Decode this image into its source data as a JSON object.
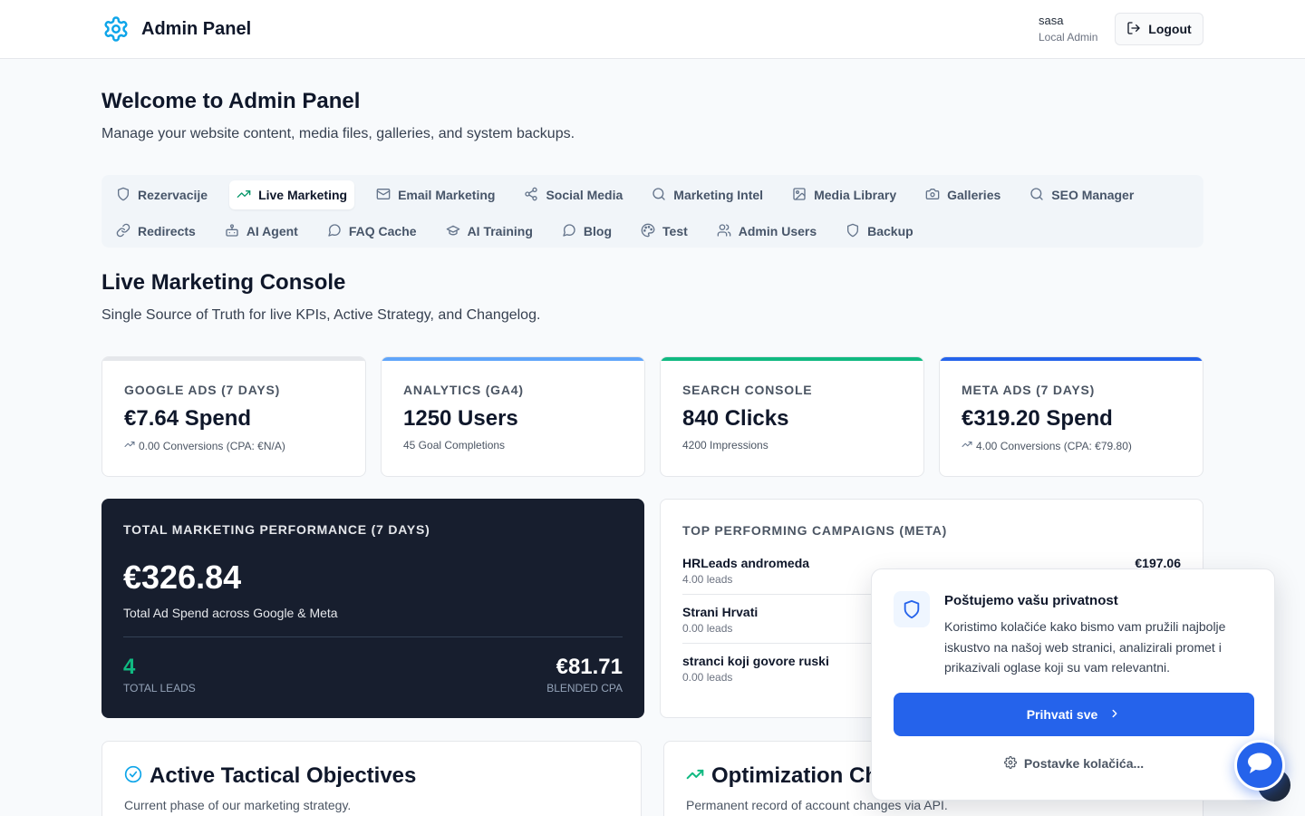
{
  "header": {
    "brand_title": "Admin Panel",
    "brand_icon": "gear-icon",
    "user_name": "sasa",
    "user_role": "Local Admin",
    "logout_label": "Logout"
  },
  "welcome": {
    "title": "Welcome to Admin Panel",
    "subtitle": "Manage your website content, media files, galleries, and system backups."
  },
  "tabs": [
    {
      "label": "Rezervacije",
      "icon": "shield-icon"
    },
    {
      "label": "Live Marketing",
      "icon": "trending-up-icon",
      "active": true
    },
    {
      "label": "Email Marketing",
      "icon": "mail-icon"
    },
    {
      "label": "Social Media",
      "icon": "share-icon"
    },
    {
      "label": "Marketing Intel",
      "icon": "search-icon"
    },
    {
      "label": "Media Library",
      "icon": "image-icon"
    },
    {
      "label": "Galleries",
      "icon": "camera-icon"
    },
    {
      "label": "SEO Manager",
      "icon": "search-icon"
    },
    {
      "label": "Redirects",
      "icon": "link-icon"
    },
    {
      "label": "AI Agent",
      "icon": "bot-icon"
    },
    {
      "label": "FAQ Cache",
      "icon": "message-circle-icon"
    },
    {
      "label": "AI Training",
      "icon": "graduation-cap-icon"
    },
    {
      "label": "Blog",
      "icon": "message-square-icon"
    },
    {
      "label": "Test",
      "icon": "palette-icon"
    },
    {
      "label": "Admin Users",
      "icon": "users-icon"
    },
    {
      "label": "Backup",
      "icon": "shield-icon"
    }
  ],
  "console": {
    "title": "Live Marketing Console",
    "subtitle": "Single Source of Truth for live KPIs, Active Strategy, and Changelog."
  },
  "kpis": [
    {
      "label": "GOOGLE ADS (7 DAYS)",
      "value": "€7.64 Spend",
      "detail": "0.00 Conversions (CPA: €N/A)",
      "accent": "#e5e7eb",
      "trend_icon": true
    },
    {
      "label": "ANALYTICS (GA4)",
      "value": "1250 Users",
      "detail": "45 Goal Completions",
      "accent": "#60a5fa",
      "trend_icon": false
    },
    {
      "label": "SEARCH CONSOLE",
      "value": "840 Clicks",
      "detail": "4200 Impressions",
      "accent": "#10b981",
      "trend_icon": false
    },
    {
      "label": "META ADS (7 DAYS)",
      "value": "€319.20 Spend",
      "detail": "4.00 Conversions (CPA: €79.80)",
      "accent": "#2563eb",
      "trend_icon": true
    }
  ],
  "performance": {
    "label": "TOTAL MARKETING PERFORMANCE (7 DAYS)",
    "total": "€326.84",
    "description": "Total Ad Spend across Google & Meta",
    "leads_value": "4",
    "leads_label": "TOTAL LEADS",
    "cpa_value": "€81.71",
    "cpa_label": "BLENDED CPA"
  },
  "campaigns": {
    "title": "TOP PERFORMING CAMPAIGNS (META)",
    "items": [
      {
        "name": "HRLeads andromeda",
        "leads": "4.00 leads",
        "spend": "€197.06"
      },
      {
        "name": "Strani Hrvati",
        "leads": "0.00 leads",
        "spend": ""
      },
      {
        "name": "stranci koji govore ruski",
        "leads": "0.00 leads",
        "spend": ""
      }
    ]
  },
  "objectives": {
    "title": "Active Tactical Objectives",
    "subtitle": "Current phase of our marketing strategy."
  },
  "changelog": {
    "title": "Optimization Ch",
    "subtitle": "Permanent record of account changes via API."
  },
  "cookie": {
    "title": "Poštujemo vašu privatnost",
    "text": "Koristimo kolačiće kako bismo vam pružili najbolje iskustvo na našoj web stranici, analizirali promet i prikazivali oglase koji su vam relevantni.",
    "accept_label": "Prihvati sve",
    "settings_label": "Postavke kolačića..."
  },
  "colors": {
    "primary": "#2563eb",
    "dark_card": "#171e2e",
    "success": "#10b981",
    "brand_icon": "#0ea5e9"
  }
}
